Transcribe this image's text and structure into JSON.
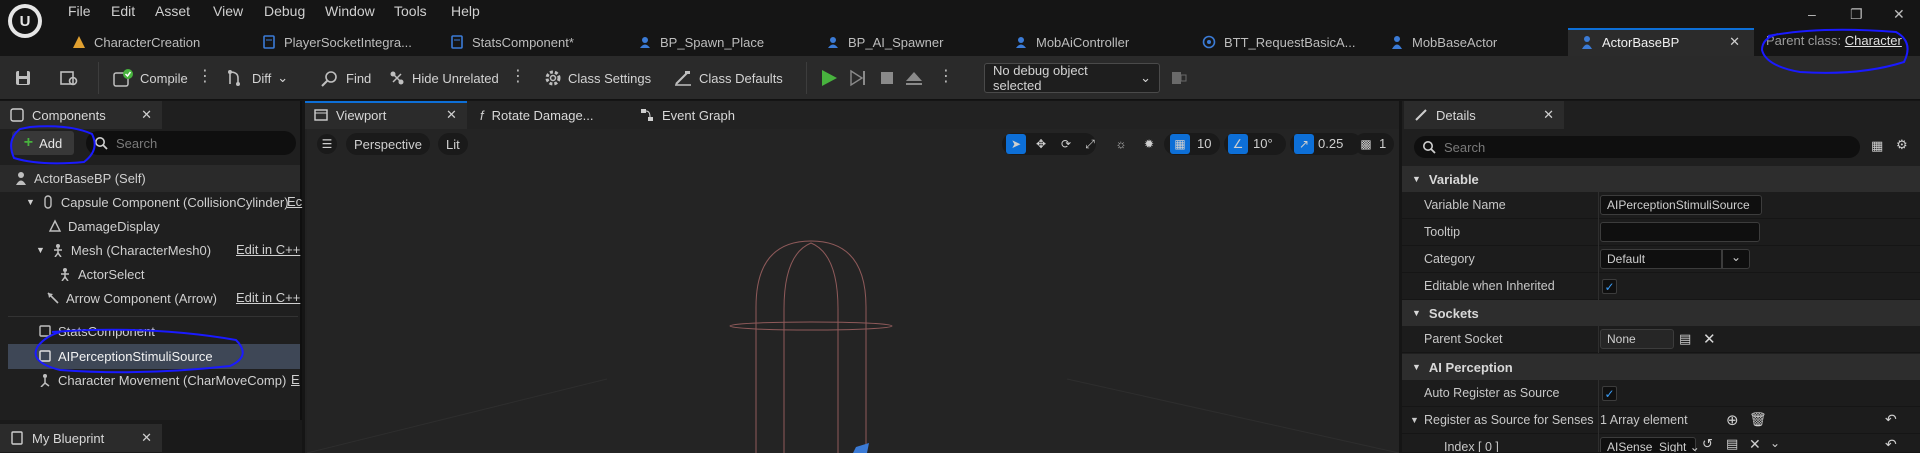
{
  "menu": {
    "items": [
      "File",
      "Edit",
      "Asset",
      "View",
      "Debug",
      "Window",
      "Tools",
      "Help"
    ]
  },
  "doc_tabs": [
    {
      "label": "CharacterCreation",
      "icon": "warning-icon",
      "color": "#e0a030"
    },
    {
      "label": "PlayerSocketIntegra...",
      "icon": "blueprint-icon",
      "color": "#3b7bd6"
    },
    {
      "label": "StatsComponent*",
      "icon": "blueprint-icon",
      "color": "#3b7bd6"
    },
    {
      "label": "BP_Spawn_Place",
      "icon": "actor-icon",
      "color": "#3b7bd6"
    },
    {
      "label": "BP_AI_Spawner",
      "icon": "actor-icon",
      "color": "#3b7bd6"
    },
    {
      "label": "MobAiController",
      "icon": "actor-icon",
      "color": "#3b7bd6"
    },
    {
      "label": "BTT_RequestBasicA...",
      "icon": "behavior-task-icon",
      "color": "#3b7bd6"
    },
    {
      "label": "MobBaseActor",
      "icon": "character-icon",
      "color": "#3b7bd6"
    },
    {
      "label": "ActorBaseBP",
      "icon": "character-icon",
      "color": "#3b7bd6"
    }
  ],
  "parent_class": {
    "label": "Parent class:",
    "value": "Character"
  },
  "toolbar": {
    "compile": "Compile",
    "diff": "Diff",
    "find": "Find",
    "hide_unrelated": "Hide Unrelated",
    "class_settings": "Class Settings",
    "class_defaults": "Class Defaults",
    "debug_object": "No debug object selected"
  },
  "components": {
    "tab_label": "Components",
    "add_label": "Add",
    "search_placeholder": "Search",
    "tree": [
      {
        "label": "ActorBaseBP (Self)"
      },
      {
        "label": "Capsule Component (CollisionCylinder)",
        "suffix": "Ec"
      },
      {
        "label": "DamageDisplay"
      },
      {
        "label": "Mesh (CharacterMesh0)",
        "suffix": "Edit in C++"
      },
      {
        "label": "ActorSelect"
      },
      {
        "label": "Arrow Component (Arrow)",
        "suffix": "Edit in C++"
      },
      {
        "label": "StatsComponent"
      },
      {
        "label": "AIPerceptionStimuliSource"
      },
      {
        "label": "Character Movement (CharMoveComp)",
        "suffix": "E"
      }
    ]
  },
  "my_blueprint": {
    "tab_label": "My Blueprint"
  },
  "viewport_tabs": {
    "viewport": "Viewport",
    "rotate_damage": "Rotate Damage...",
    "event_graph": "Event Graph"
  },
  "viewport": {
    "perspective": "Perspective",
    "lit": "Lit",
    "grid_value": "10",
    "angle_value": "10°",
    "scale_value": "0.25",
    "camera_speed": "1"
  },
  "details": {
    "tab_label": "Details",
    "search_placeholder": "Search",
    "sections": {
      "variable": "Variable",
      "sockets": "Sockets",
      "ai_perception": "AI Perception"
    },
    "variable_name_label": "Variable Name",
    "variable_name_value": "AIPerceptionStimuliSource",
    "tooltip_label": "Tooltip",
    "tooltip_value": "",
    "category_label": "Category",
    "category_value": "Default",
    "editable_label": "Editable when Inherited",
    "parent_socket_label": "Parent Socket",
    "parent_socket_value": "None",
    "auto_register_label": "Auto Register as Source",
    "register_senses_label": "Register as Source for Senses",
    "register_senses_value": "1 Array element",
    "index_label": "Index [ 0 ]",
    "index_value": "AISense_Sight"
  },
  "colors": {
    "accent": "#0d6fd7",
    "play_green": "#48b33e",
    "selection": "#3e4756",
    "annotation": "#1a1aff"
  }
}
